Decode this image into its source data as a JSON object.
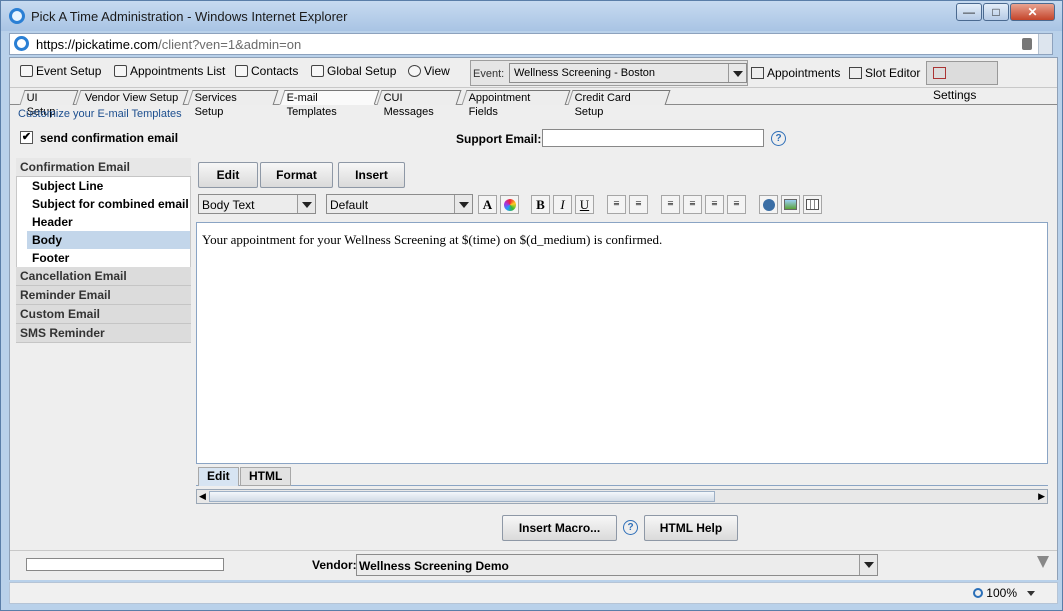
{
  "window": {
    "title": "Pick A Time Administration - Windows Internet Explorer"
  },
  "address": {
    "url_host": "https://pickatime.com",
    "url_rest": "/client?ven=1&admin=on"
  },
  "toolbar": {
    "left_items": [
      "Event Setup",
      "Appointments List",
      "Contacts",
      "Global Setup",
      "View"
    ],
    "event_label": "Event:",
    "event_value": "Wellness Screening - Boston",
    "right_tabs": [
      "Appointments",
      "Slot Editor",
      "Settings"
    ],
    "active_right_tab": "Settings"
  },
  "subtabs": [
    "UI Setup",
    "Vendor View Setup",
    "Services Setup",
    "E-mail Templates",
    "CUI Messages",
    "Appointment Fields",
    "Credit Card Setup"
  ],
  "active_subtab": "E-mail Templates",
  "header": {
    "customize": "Customize your E-mail Templates",
    "send_confirmation_label": "send confirmation email",
    "send_confirmation_checked": true,
    "checkbox_mark": "✔",
    "support_email_label": "Support Email:",
    "support_email_value": ""
  },
  "templates": {
    "confirmation": "Confirmation Email",
    "sub_items": [
      "Subject Line",
      "Subject for combined email",
      "Header",
      "Body",
      "Footer"
    ],
    "selected_sub": "Body",
    "others": [
      "Cancellation Email",
      "Reminder Email",
      "Custom Email",
      "SMS Reminder"
    ]
  },
  "editor": {
    "menu_buttons": [
      "Edit",
      "Format",
      "Insert"
    ],
    "style_value": "Body Text",
    "font_value": "Default",
    "format_buttons": {
      "bold": "B",
      "italic": "I",
      "underline": "U"
    },
    "body_text": "Your appointment for your Wellness Screening at $(time) on $(d_medium) is confirmed.",
    "bottom_tabs": [
      "Edit",
      "HTML"
    ],
    "active_bottom_tab": "Edit"
  },
  "actions": {
    "insert_macro": "Insert Macro...",
    "html_help": "HTML Help",
    "help_glyph": "?"
  },
  "vendor": {
    "label": "Vendor:",
    "value": "Wellness Screening Demo"
  },
  "status": {
    "zoom": "100%"
  }
}
